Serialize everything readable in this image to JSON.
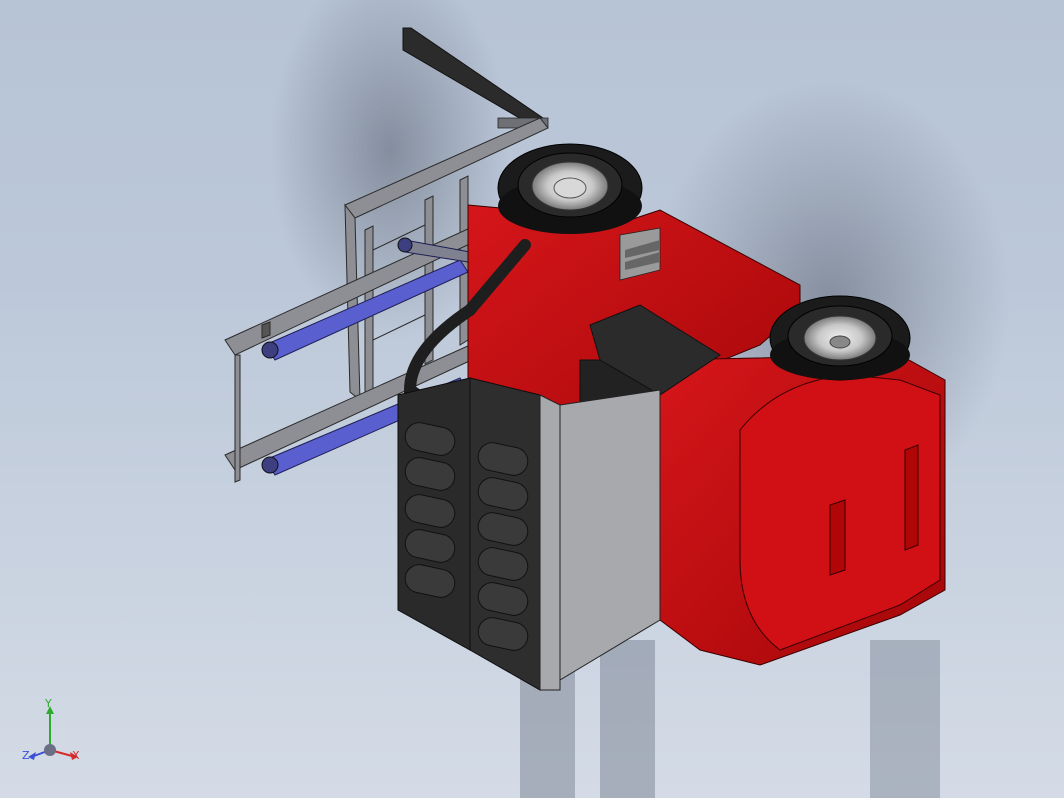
{
  "viewport": {
    "model": "forklift-assembly",
    "parts": {
      "body": {
        "color": "#c80b0b"
      },
      "tires": {
        "color": "#1b1b1b"
      },
      "hydraulic_cylinders": {
        "color": "#5a5fd0"
      },
      "frame": {
        "color": "#8d8f94"
      },
      "counterweight": {
        "color": "#2b2b2b"
      }
    }
  },
  "triad": {
    "y_label": "Y",
    "x_label": "X",
    "z_label": "Z",
    "y_color": "#2eaa2e",
    "x_color": "#d62a2a",
    "z_color": "#3a4fd8"
  }
}
